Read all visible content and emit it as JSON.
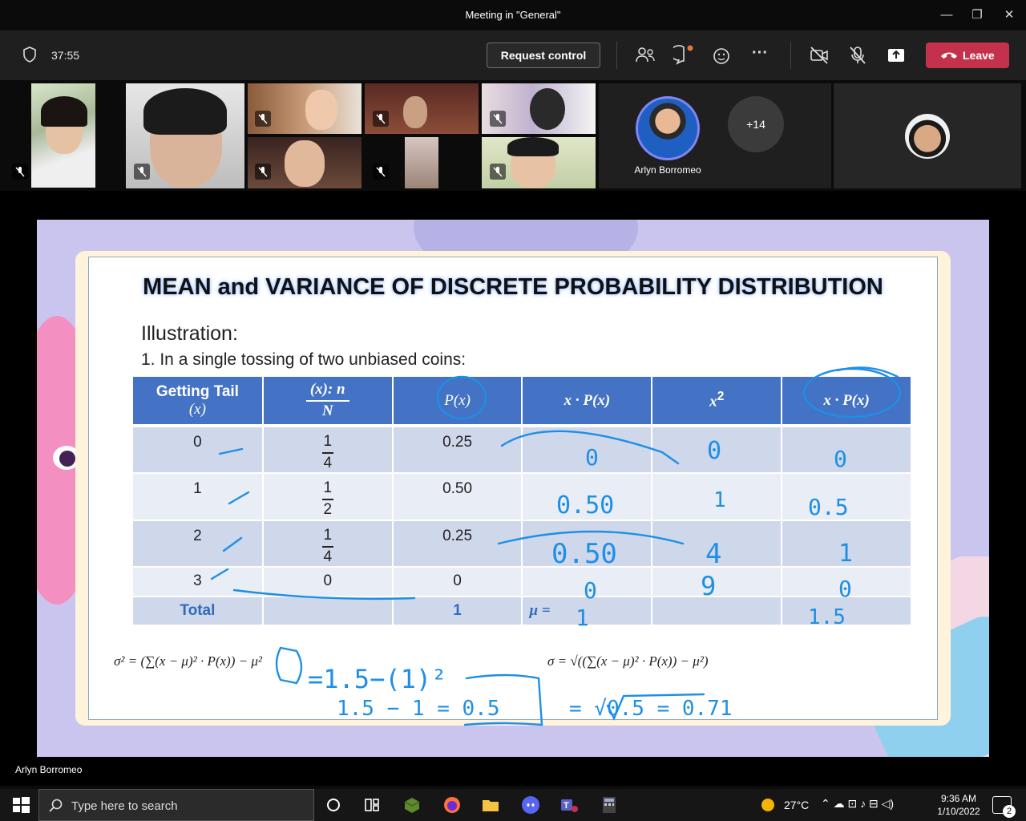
{
  "window": {
    "title": "Meeting in \"General\""
  },
  "toolbar": {
    "timer": "37:55",
    "request_control": "Request control",
    "leave": "Leave"
  },
  "participants": {
    "presenter_name": "Arlyn Borromeo",
    "more_count": "+14"
  },
  "slide": {
    "title": "MEAN and VARIANCE OF DISCRETE PROBABILITY DISTRIBUTION",
    "subtitle": "Illustration:",
    "question": "1.  In a single tossing of two unbiased coins:",
    "headers": {
      "getting_tail": "Getting Tail",
      "x_paren": "(x)",
      "xn_num": "(x): n",
      "xn_den": "N",
      "px": "P(x)",
      "xpx": "x · P(x)",
      "x2": "x",
      "x2px": "x · P(x)"
    },
    "rows": [
      {
        "x": "0",
        "num": "1",
        "den": "4",
        "p": "0.25"
      },
      {
        "x": "1",
        "num": "1",
        "den": "2",
        "p": "0.50"
      },
      {
        "x": "2",
        "num": "1",
        "den": "4",
        "p": "0.25"
      },
      {
        "x": "3",
        "num": "0",
        "p": "0"
      }
    ],
    "total_row": {
      "label": "Total",
      "p_total": "1",
      "mu": "μ ="
    },
    "formula_variance": "σ² = (∑(x − μ)² · P(x)) − μ²",
    "formula_sd": "σ = √((∑(x − μ)² · P(x)) − μ²)"
  },
  "annotations": {
    "xpx": [
      "0",
      "0.50",
      "0.50",
      "0",
      "1"
    ],
    "x2": [
      "0",
      "1",
      "4",
      "9"
    ],
    "x2px": [
      "0",
      "0.5",
      "1",
      "0",
      "1.5"
    ],
    "var_line1": "=1.5−(1)²",
    "var_line2": "1.5 − 1 = 0.5",
    "sd_line": "= √0.5 = 0.71"
  },
  "taskbar": {
    "search_placeholder": "Type here to search",
    "temperature": "27°C",
    "time": "9:36 AM",
    "date": "1/10/2022",
    "notifications": "2"
  },
  "colors": {
    "leave": "#c4314b",
    "table_header": "#4472c4",
    "ink": "#1e8fe6"
  }
}
